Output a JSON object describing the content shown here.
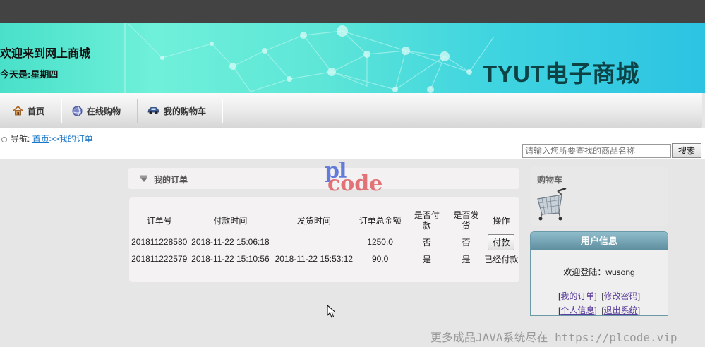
{
  "header": {
    "welcome": "欢迎来到网上商城",
    "today": "今天是:星期四",
    "brand": "TYUT电子商城"
  },
  "nav": [
    {
      "label": "首页",
      "icon": "home-icon"
    },
    {
      "label": "在线购物",
      "icon": "globe-icon"
    },
    {
      "label": "我的购物车",
      "icon": "car-icon"
    }
  ],
  "breadcrumb": {
    "prefix": "导航:",
    "home_link": "首页",
    "current": ">>我的订单"
  },
  "search": {
    "placeholder": "请输入您所要查找的商品名称",
    "button": "搜索"
  },
  "orders_panel": {
    "title": "我的订单",
    "columns": [
      "订单号",
      "付款时间",
      "发货时间",
      "订单总金额",
      "是否付款",
      "是否发货",
      "操作"
    ],
    "rows": [
      {
        "order_no": "201811228580",
        "paid_at": "2018-11-22 15:06:18",
        "shipped_at": "",
        "total": "1250.0",
        "paid": "否",
        "shipped": "否",
        "action": "付款"
      },
      {
        "order_no": "201811222579",
        "paid_at": "2018-11-22 15:10:56",
        "shipped_at": "2018-11-22 15:53:12",
        "total": "90.0",
        "paid": "是",
        "shipped": "是",
        "action": "已经付款"
      }
    ]
  },
  "cart_box": {
    "title": "购物车",
    "icon": "shopping-cart-icon"
  },
  "user_box": {
    "title": "用户信息",
    "welcome": "欢迎登陆：wusong",
    "my_orders": "我的订单",
    "change_password": "修改密码",
    "profile": "个人信息",
    "logout": "退出系统"
  },
  "watermarks": {
    "logo_top": "pl",
    "logo_bottom": "code",
    "footer": "更多成品JAVA系统尽在 https://plcode.vip"
  },
  "colors": {
    "topbar": "#434343",
    "banner_start": "#49e0c9",
    "banner_end": "#2cc3e3",
    "brand_text": "#0e4346",
    "link": "#1a77c9",
    "user_head": "#6b9aab"
  }
}
